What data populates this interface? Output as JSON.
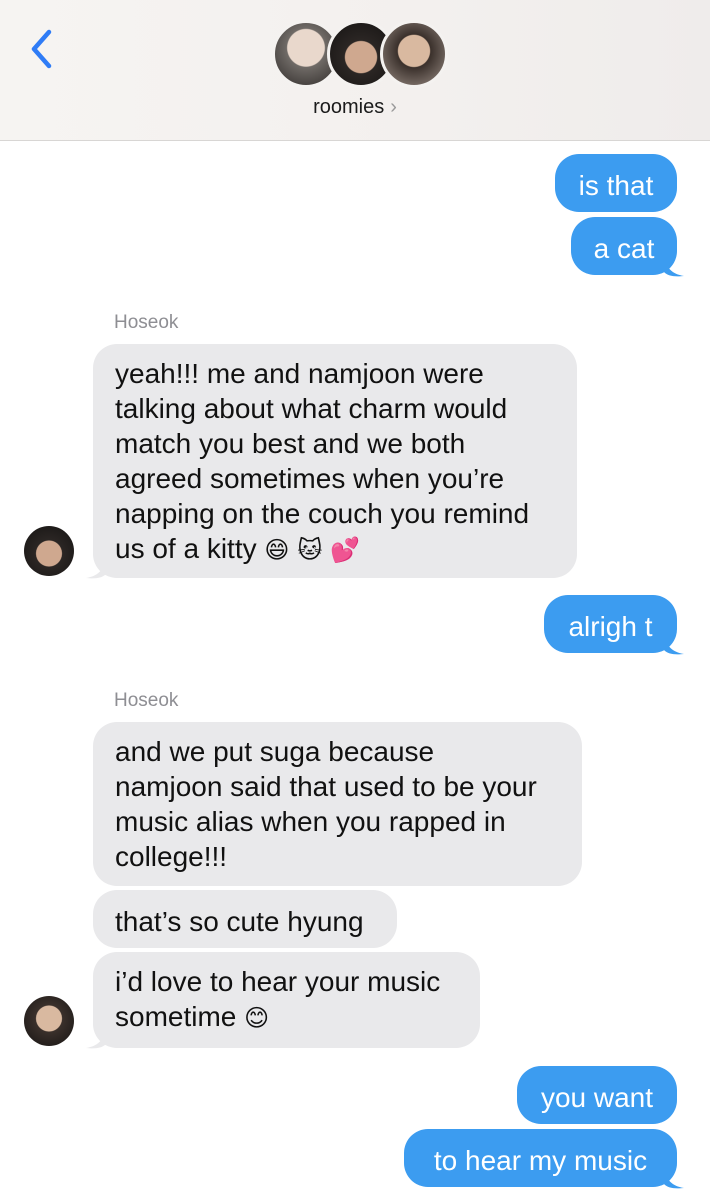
{
  "header": {
    "back_icon": "chevron-left-icon",
    "group_name": "roomies",
    "chevron": "›",
    "accent": "#2f7cf6"
  },
  "colors": {
    "outgoing": "#3c9cf0",
    "incoming": "#e9e9eb"
  },
  "messages": [
    {
      "direction": "outgoing",
      "text": "is that"
    },
    {
      "direction": "outgoing",
      "text": "a cat"
    },
    {
      "direction": "incoming",
      "sender": "Hoseok",
      "lines": [
        "yeah!!! me and namjoon were",
        "talking about what charm would",
        "match you best and we both",
        "agreed sometimes when you’re",
        "napping on the couch you remind",
        "us of a kitty"
      ],
      "emojis": [
        "😄",
        "🐱",
        "💕"
      ]
    },
    {
      "direction": "outgoing",
      "text": "alrigh t"
    },
    {
      "direction": "incoming",
      "sender": "Hoseok",
      "lines": [
        "and we put suga because",
        "namjoon said that used to be your",
        "music alias when you rapped in",
        "college!!!"
      ]
    },
    {
      "direction": "incoming",
      "text": "that’s so cute hyung"
    },
    {
      "direction": "incoming",
      "lines": [
        "i’d love to hear your music",
        "sometime"
      ],
      "emojis": [
        "😊"
      ]
    },
    {
      "direction": "outgoing",
      "text": "you want"
    },
    {
      "direction": "outgoing",
      "text": "to hear my music"
    }
  ]
}
